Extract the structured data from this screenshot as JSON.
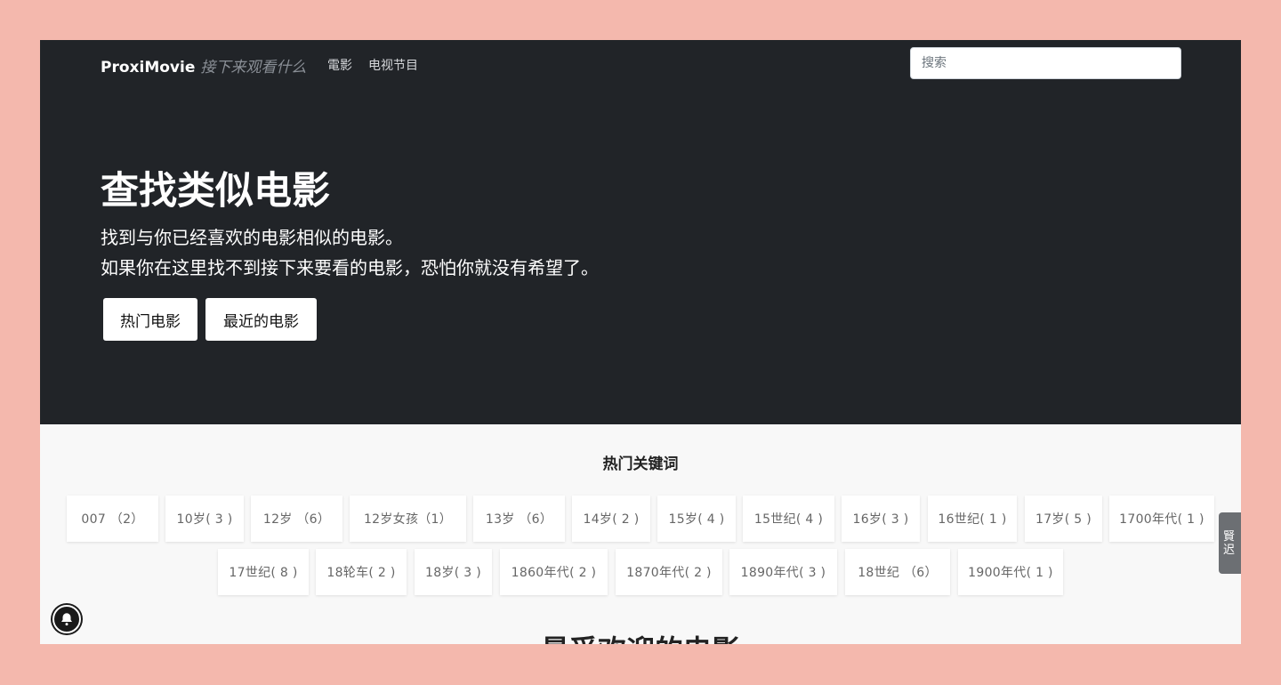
{
  "nav": {
    "brand": "ProxiMovie",
    "tagline": "接下来观看什么",
    "links": [
      "電影",
      "电视节目"
    ],
    "search_placeholder": "搜索"
  },
  "hero": {
    "title": "查找类似电影",
    "line1": "找到与你已经喜欢的电影相似的电影。",
    "line2": "如果你在这里找不到接下来要看的电影，恐怕你就没有希望了。",
    "buttons": [
      "热门电影",
      "最近的电影"
    ]
  },
  "keywords": {
    "title": "热门关键词",
    "row1": [
      "007 （2）",
      "10岁( 3 )",
      "12岁 （6）",
      "12岁女孩（1）",
      "13岁 （6）",
      "14岁( 2 )",
      "15岁( 4 )",
      "15世纪( 4 )",
      "16岁( 3 )",
      "16世纪( 1 )",
      "17岁( 5 )",
      "1700年代( 1 )"
    ],
    "row2": [
      "17世纪( 8 )",
      "18轮车( 2 )",
      "18岁( 3 )",
      "1860年代( 2 )",
      "1870年代( 2 )",
      "1890年代( 3 )",
      "18世纪 （6）",
      "1900年代( 1 )"
    ]
  },
  "side_tab": {
    "label": "賢 迟"
  },
  "next_section": {
    "title": "最受欢迎的电影"
  },
  "icons": {
    "bell": "bell-icon"
  }
}
